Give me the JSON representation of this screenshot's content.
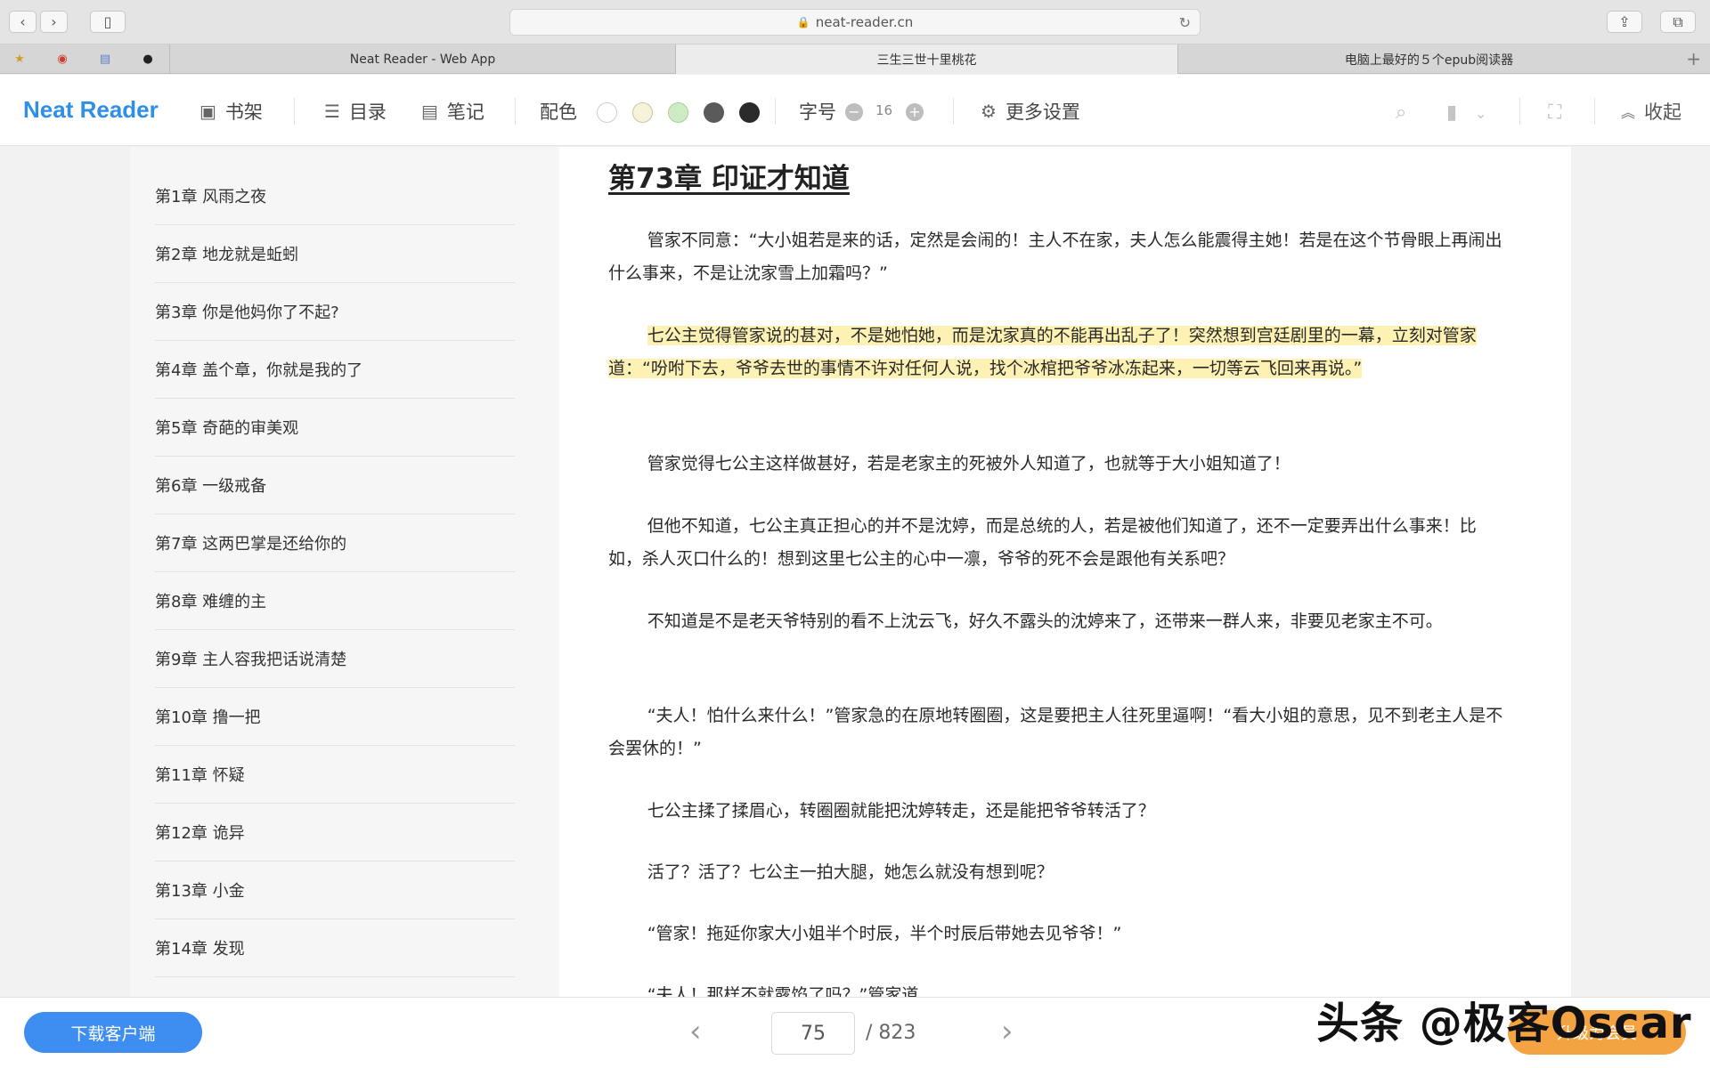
{
  "browser": {
    "url": "neat-reader.cn",
    "tabs": [
      "Neat Reader - Web App",
      "三生三世十里桃花",
      "电脑上最好的５个epub阅读器"
    ],
    "active_tab": 1
  },
  "toolbar": {
    "brand": "Neat Reader",
    "bookshelf": "书架",
    "toc": "目录",
    "notes": "笔记",
    "color_scheme": "配色",
    "font_size_label": "字号",
    "font_size_value": "16",
    "more_settings": "更多设置",
    "collapse": "收起",
    "swatches": [
      "#ffffff",
      "#f5f3dc",
      "#cdebc5",
      "#5a5a5a",
      "#2a2a2a"
    ]
  },
  "toc": {
    "items": [
      "第1章 风雨之夜",
      "第2章 地龙就是蚯蚓",
      "第3章 你是他妈你了不起?",
      "第4章 盖个章，你就是我的了",
      "第5章 奇葩的审美观",
      "第6章 一级戒备",
      "第7章 这两巴掌是还给你的",
      "第8章 难缠的主",
      "第9章 主人容我把话说清楚",
      "第10章 撸一把",
      "第11章 怀疑",
      "第12章 诡异",
      "第13章 小金",
      "第14章 发现"
    ]
  },
  "chapter": {
    "title": "第73章 印证才知道",
    "paragraphs": [
      "管家不同意：“大小姐若是来的话，定然是会闹的！主人不在家，夫人怎么能震得主她！若是在这个节骨眼上再闹出什么事来，不是让沈家雪上加霜吗？”",
      "七公主觉得管家说的甚对，不是她怕她，而是沈家真的不能再出乱子了！突然想到宫廷剧里的一幕，立刻对管家道：“吩咐下去，爷爷去世的事情不许对任何人说，找个冰棺把爷爷冰冻起来，一切等云飞回来再说。”",
      "管家觉得七公主这样做甚好，若是老家主的死被外人知道了，也就等于大小姐知道了！",
      "但他不知道，七公主真正担心的并不是沈婷，而是总统的人，若是被他们知道了，还不一定要弄出什么事来！比如，杀人灭口什么的！想到这里七公主的心中一凛，爷爷的死不会是跟他有关系吧？",
      "不知道是不是老天爷特别的看不上沈云飞，好久不露头的沈婷来了，还带来一群人来，非要见老家主不可。",
      "“夫人！怕什么来什么！”管家急的在原地转圈圈，这是要把主人往死里逼啊！“看大小姐的意思，见不到老主人是不会罢休的！”",
      "七公主揉了揉眉心，转圈圈就能把沈婷转走，还是能把爷爷转活了？",
      "活了？活了？七公主一拍大腿，她怎么就没有想到呢？",
      "“管家！拖延你家大小姐半个时辰，半个时辰后带她去见爷爷！”",
      "“夫人！那样不就露馅了吗？”管家道"
    ]
  },
  "footer": {
    "download": "下载客户端",
    "page_current": "75",
    "page_total": "/ 823",
    "upgrade": "升级为会员"
  },
  "watermark": "头条 @极客Oscar"
}
